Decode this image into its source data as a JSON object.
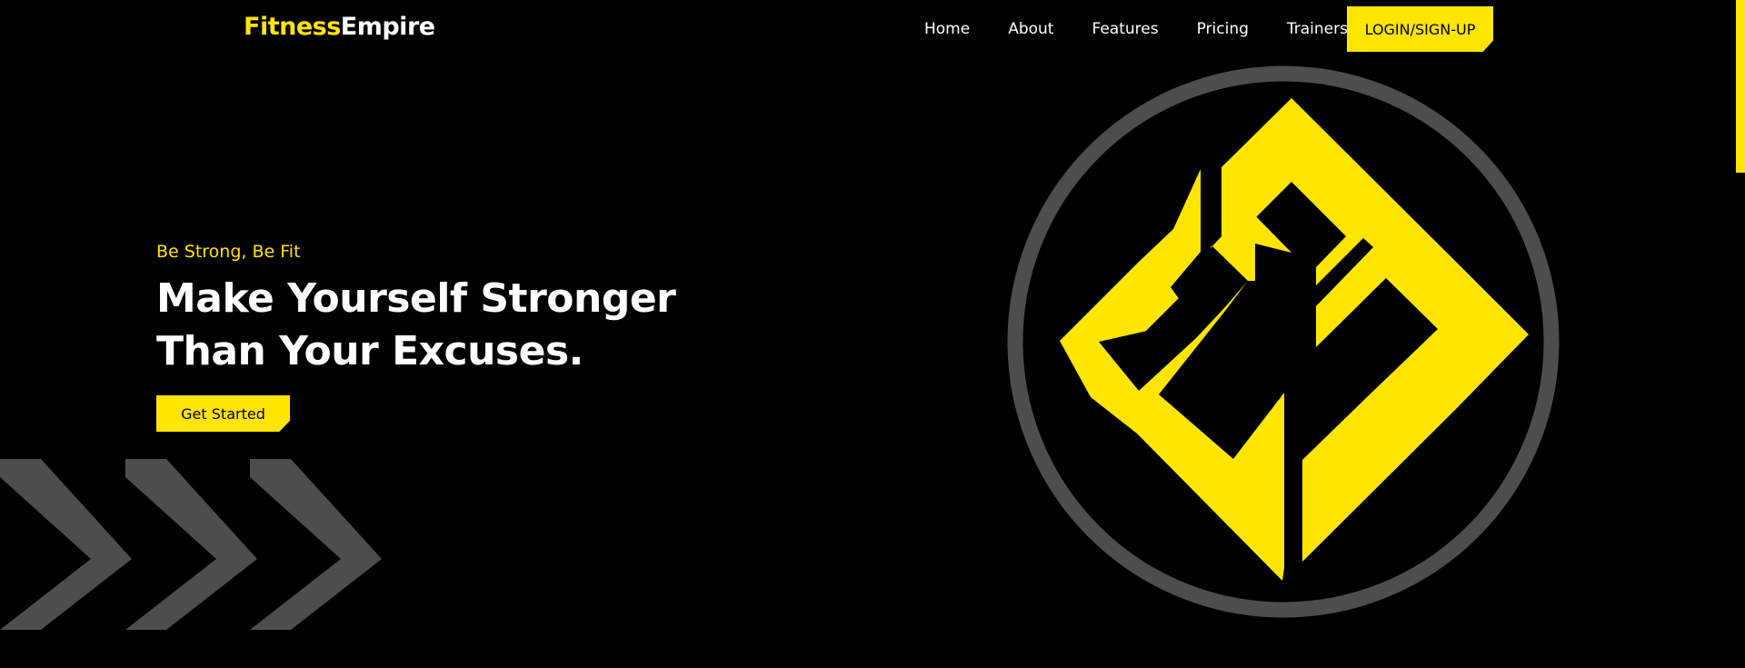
{
  "brand": {
    "part1": "Fitness",
    "part2": "Empire"
  },
  "nav": {
    "items": [
      "Home",
      "About",
      "Features",
      "Pricing",
      "Trainers"
    ],
    "login_label": "LOGIN/SIGN-UP"
  },
  "hero": {
    "tagline": "Be Strong, Be Fit",
    "headline_line1": "Make Yourself Stronger",
    "headline_line2": "Than Your Excuses.",
    "cta_label": "Get Started"
  },
  "colors": {
    "accent": "#FFE500",
    "background": "#000000",
    "text": "#FFFFFF",
    "decor_gray": "#4d4d4d"
  },
  "icons": {
    "emblem": "fitness-empire-emblem",
    "chevrons": "chevron-right-icon"
  }
}
